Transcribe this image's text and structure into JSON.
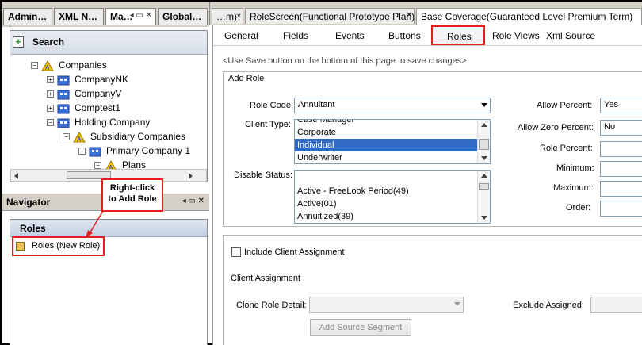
{
  "left_tabs": [
    {
      "label": "Admin…"
    },
    {
      "label": "XML N…"
    },
    {
      "label": "Ma…",
      "controls": "◂ ▭ ✕"
    },
    {
      "label": "Global…"
    }
  ],
  "search": {
    "label": "Search"
  },
  "tree": [
    {
      "label": "Companies"
    },
    {
      "label": "CompanyNK"
    },
    {
      "label": "CompanyV"
    },
    {
      "label": "Comptest1"
    },
    {
      "label": "Holding Company"
    },
    {
      "label": "Subsidiary Companies"
    },
    {
      "label": "Primary Company 1"
    },
    {
      "label": "Plans"
    }
  ],
  "navigator": {
    "title": "Navigator",
    "controls": "◂ ▭ ✕",
    "section_title": "Roles",
    "item_label": "Roles (New Role)"
  },
  "callout": {
    "text": "Right-click to Add Role"
  },
  "editor_tabs": [
    {
      "label": "…m)*"
    },
    {
      "label": "RoleScreen(Functional Prototype Plan)"
    },
    {
      "label": "Base Coverage(Guaranteed Level Premium Term)"
    }
  ],
  "sub_tabs": [
    "General",
    "Fields",
    "Events",
    "Buttons",
    "Roles",
    "Role Views",
    "Xml Source"
  ],
  "hint": "<Use Save button on the bottom of this page to save changes>",
  "add_role": {
    "title": "Add Role",
    "role_code_label": "Role Code:",
    "role_code_value": "Annuitant",
    "client_type_label": "Client Type:",
    "client_type_options": [
      "Case Manager",
      "Corporate",
      "Individual",
      "Underwriter"
    ],
    "client_type_selected": "Individual",
    "disable_status_label": "Disable Status:",
    "disable_status_options": [
      "",
      "Active - FreeLook Period(49)",
      "Active(01)",
      "Annuitized(39)"
    ],
    "allow_percent_label": "Allow Percent:",
    "allow_percent_value": "Yes",
    "allow_zero_percent_label": "Allow Zero Percent:",
    "allow_zero_percent_value": "No",
    "role_percent_label": "Role Percent:",
    "minimum_label": "Minimum:",
    "maximum_label": "Maximum:",
    "order_label": "Order:"
  },
  "client_assignment": {
    "include_label": "Include Client Assignment",
    "section_title": "Client Assignment",
    "clone_label": "Clone Role Detail:",
    "exclude_label": "Exclude Assigned:",
    "add_source_button": "Add Source Segment"
  },
  "colors": {
    "accent": "#316ac5",
    "callout": "#e41e1e",
    "search_plus": "#2a9b2a"
  }
}
